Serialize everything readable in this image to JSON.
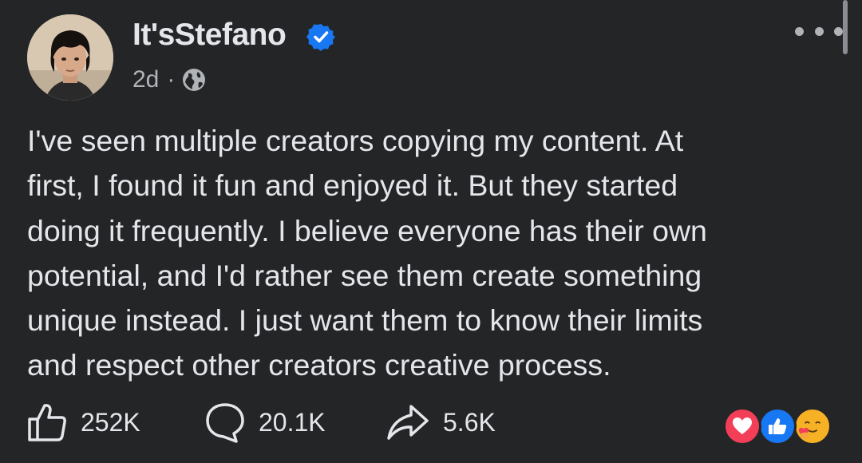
{
  "post": {
    "author": {
      "name": "It'sStefano",
      "verified": true,
      "avatar": "profile-photo"
    },
    "meta": {
      "time": "2d",
      "separator": "·",
      "audience_icon": "globe-icon"
    },
    "more_icon": "more-horizontal-icon",
    "text_lines": [
      "I've seen multiple creators copying my content. At",
      "first, I found it fun and enjoyed it. But they started",
      "doing it frequently. I believe everyone has their own",
      "potential, and I'd rather see them create something",
      "unique instead. I just want them to know their limits",
      "and respect other creators creative process."
    ],
    "actions": {
      "like": {
        "icon": "thumbs-up-icon",
        "count": "252K"
      },
      "comment": {
        "icon": "comment-icon",
        "count": "20.1K"
      },
      "share": {
        "icon": "share-icon",
        "count": "5.6K"
      }
    },
    "reactions": [
      {
        "type": "love",
        "icon": "heart-icon",
        "color": "#f33e58"
      },
      {
        "type": "like",
        "icon": "thumbs-up-icon",
        "color": "#1877f2"
      },
      {
        "type": "care",
        "icon": "care-emoji-icon",
        "color": "#f7b125"
      }
    ]
  },
  "colors": {
    "background": "#242526",
    "text_primary": "#e4e6eb",
    "text_secondary": "#b0b3b8",
    "verified_badge": "#1877f2"
  }
}
